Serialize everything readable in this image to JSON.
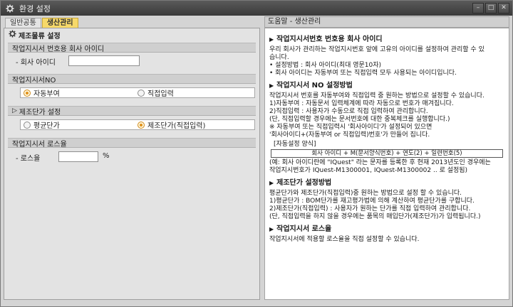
{
  "window": {
    "title": "환경 설정",
    "icon": "gear-icon",
    "min_label": "–",
    "max_label": "□",
    "close_label": "✕"
  },
  "tabs": [
    {
      "label": "일반공통",
      "active": false
    },
    {
      "label": "생산관리",
      "active": true
    }
  ],
  "left": {
    "header": "제조물류 설정",
    "sections": {
      "s1": {
        "title": "작업지시서 번호용 회사 아이디",
        "field_label": "- 회사 아이디",
        "field_value": ""
      },
      "s2": {
        "title": "작업지시서NO",
        "opt1": "자동부여",
        "opt2": "직접입력",
        "selected": "자동부여"
      },
      "s3": {
        "title": "제조단가 설정",
        "opt1": "평균단가",
        "opt2": "제조단가(직접입력)",
        "selected": "제조단가(직접입력)"
      },
      "s4": {
        "title": "작업지시서 로스율",
        "field_label": "- 로스율",
        "field_value": "",
        "unit": "%"
      }
    }
  },
  "help": {
    "title": "도움말 - 생산관리",
    "h1": "작업지시서번호 번호용 회사 아이디",
    "p1": "우리 회사가 관리하는 작업지시번호 앞에 고유의 아이디를 설정하여 관리할 수 있\n습니다.\n• 설정방법 : 회사 아이디(최대 영문10자)\n• 회사 아이디는 자동부여 또는 직접입력 모두 사용되는 아이디입니다.",
    "h2": "작업지시서 NO 설정방법",
    "p2": "작업지시서 번호를 자동부여와 직접입력 중 원하는 방법으로 설정할 수 있습니다.\n1)자동부여 : 자동문서 입력체계에 따라 자동으로 번호가 매겨집니다.\n2)직접입력 : 사용자가 수동으로 직접 입력하여 관리합니다.\n(단, 직접입력할 경우에는 문서번호에 대한 중복체크를 실행합니다.)\n※ 자동부여 또는 직접입력시 '회사아이디'가 설정되어 있으면\n'회사아이디+(자동부여 or 직접입력)번호'가 만들어 집니다.",
    "box_label": "[자동설정 양식]",
    "formula": "회사 아이디 + M(문서양식번호) + 연도(2) + 일련번호(5)",
    "p2b": "(예: 회사 아이디란에 \"IQuest\" 라는 문자를 등록한 후 현재 2013년도인 경우에는\n작업지시번호가 IQuest-M1300001, IQuest-M1300002 .. 로 설정됨)",
    "h3": "제조단가 설정방법",
    "p3": "평균단가와 제조단가(직접입력)중 원하는 방법으로 설정 할 수 있습니다.\n1)평균단가 : BOM단가를 재고평가법에 의해 계산하여 평균단가를 구합니다.\n2)제조단가(직접입력) : 사용자가 원하는 단가를 직접 입력하여 관리합니다.\n(단, 직접입력을 하지 않을 경우에는 품목의 매입단가(제조단가)가 입력됩니다.)",
    "h4": "작업지시서 로스율",
    "p4": "작업지시서에 적용할 로스율을 직접 설정할 수 있습니다."
  },
  "colors": {
    "titlebar": "#4a4a4a",
    "tab_active": "#f7d96a",
    "radio_accent": "#e0901a"
  }
}
